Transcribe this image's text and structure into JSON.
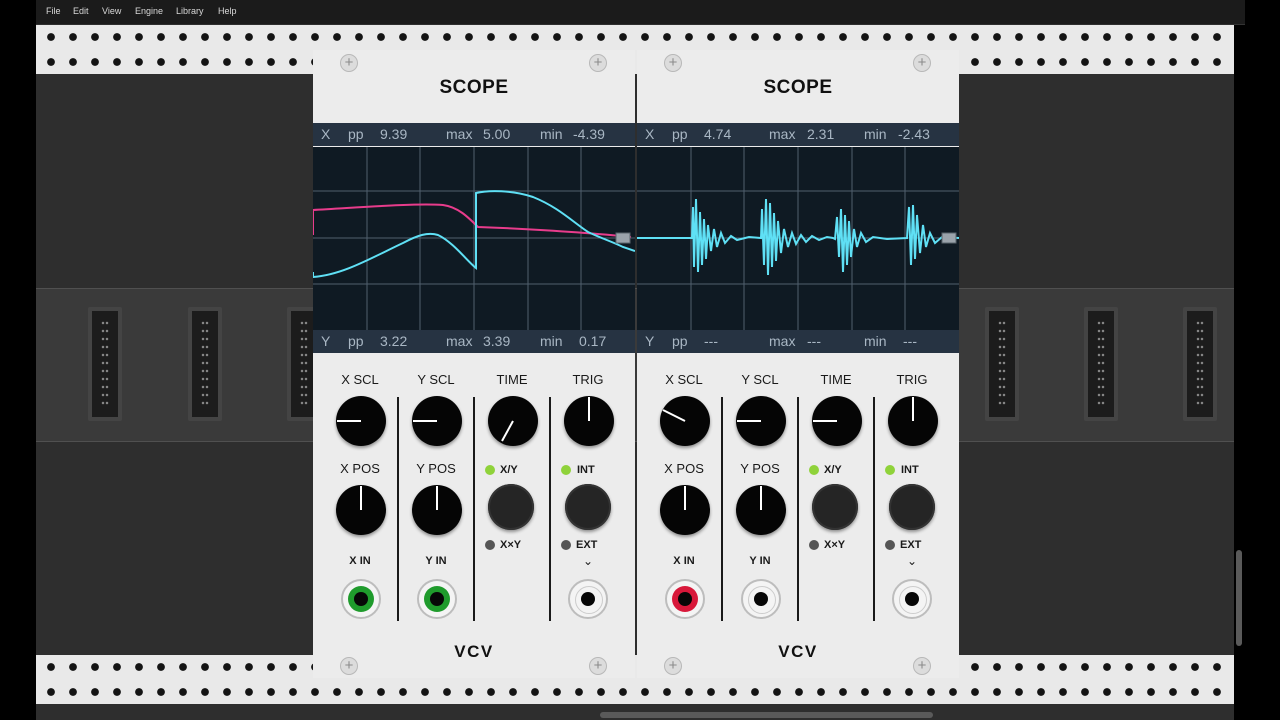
{
  "menu": [
    "File",
    "Edit",
    "View",
    "Engine",
    "Library",
    "Help"
  ],
  "modules": [
    {
      "title": "SCOPE",
      "x_bar": {
        "channel": "X",
        "pp_label": "pp",
        "pp": "9.39",
        "max_label": "max",
        "max": "5.00",
        "min_label": "min",
        "min": "-4.39"
      },
      "y_bar": {
        "channel": "Y",
        "pp_label": "pp",
        "pp": "3.22",
        "max_label": "max",
        "max": "3.39",
        "min_label": "min",
        "min": "0.17"
      },
      "labels": {
        "x_scl": "X SCL",
        "y_scl": "Y SCL",
        "time": "TIME",
        "trig": "TRIG",
        "x_pos": "X POS",
        "y_pos": "Y POS",
        "xy": "X/Y",
        "xxy": "X×Y",
        "int": "INT",
        "ext": "EXT",
        "x_in": "X IN",
        "y_in": "Y IN"
      },
      "brand": "VCV",
      "jack_colors": {
        "x_in": "#1f9b2c",
        "y_in": "#1f9b2c",
        "ext": "#f4f4f4"
      }
    },
    {
      "title": "SCOPE",
      "x_bar": {
        "channel": "X",
        "pp_label": "pp",
        "pp": "4.74",
        "max_label": "max",
        "max": "2.31",
        "min_label": "min",
        "min": "-2.43"
      },
      "y_bar": {
        "channel": "Y",
        "pp_label": "pp",
        "pp": "---",
        "max_label": "max",
        "max": "---",
        "min_label": "min",
        "min": "---"
      },
      "labels": {
        "x_scl": "X SCL",
        "y_scl": "Y SCL",
        "time": "TIME",
        "trig": "TRIG",
        "x_pos": "X POS",
        "y_pos": "Y POS",
        "xy": "X/Y",
        "xxy": "X×Y",
        "int": "INT",
        "ext": "EXT",
        "x_in": "X IN",
        "y_in": "Y IN"
      },
      "brand": "VCV",
      "jack_colors": {
        "x_in": "#d8183a",
        "y_in": "#f4f4f4",
        "ext": "#f4f4f4"
      }
    }
  ],
  "colors": {
    "trace_x": "#5fe0f5",
    "trace_y": "#e83c8c",
    "led_on": "#8fd23a",
    "led_off": "#555555"
  }
}
